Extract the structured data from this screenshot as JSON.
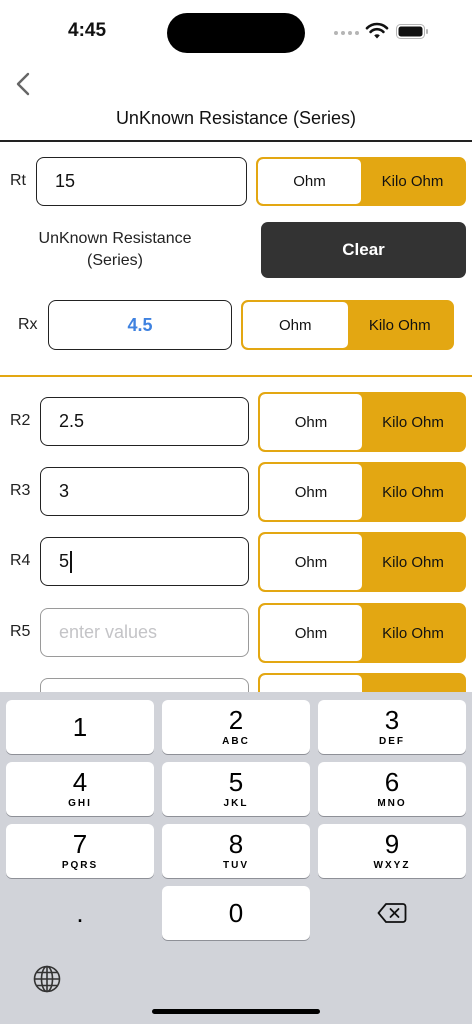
{
  "status": {
    "time": "4:45"
  },
  "nav": {
    "title": "UnKnown Resistance (Series)"
  },
  "rt": {
    "label": "Rt",
    "value": "15",
    "unit_left": "Ohm",
    "unit_right": "Kilo Ohm"
  },
  "calc": {
    "description": "UnKnown Resistance (Series)",
    "clear_label": "Clear"
  },
  "rx": {
    "label": "Rx",
    "value": "4.5",
    "unit_left": "Ohm",
    "unit_right": "Kilo Ohm"
  },
  "rows": [
    {
      "label": "R2",
      "value": "2.5",
      "unit_left": "Ohm",
      "unit_right": "Kilo Ohm"
    },
    {
      "label": "R3",
      "value": "3",
      "unit_left": "Ohm",
      "unit_right": "Kilo Ohm"
    },
    {
      "label": "R4",
      "value": "5",
      "unit_left": "Ohm",
      "unit_right": "Kilo Ohm"
    },
    {
      "label": "R5",
      "placeholder": "enter values",
      "unit_left": "Ohm",
      "unit_right": "Kilo Ohm"
    }
  ],
  "keyboard": {
    "keys": [
      {
        "num": "1",
        "sub": ""
      },
      {
        "num": "2",
        "sub": "ABC"
      },
      {
        "num": "3",
        "sub": "DEF"
      },
      {
        "num": "4",
        "sub": "GHI"
      },
      {
        "num": "5",
        "sub": "JKL"
      },
      {
        "num": "6",
        "sub": "MNO"
      },
      {
        "num": "7",
        "sub": "PQRS"
      },
      {
        "num": "8",
        "sub": "TUV"
      },
      {
        "num": "9",
        "sub": "WXYZ"
      }
    ],
    "dot": ".",
    "zero": "0",
    "delete_icon": "delete-backspace-icon",
    "globe_icon": "globe-icon"
  },
  "colors": {
    "accent": "#e3a712",
    "result": "#3f82e0",
    "clear_bg": "#333333",
    "keyboard_bg": "#d1d3d9"
  }
}
